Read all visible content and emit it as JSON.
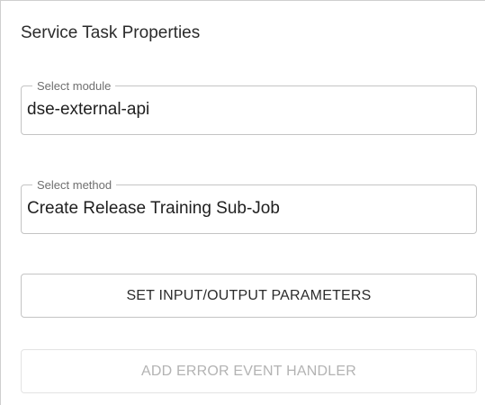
{
  "panel": {
    "title": "Service Task Properties"
  },
  "module_field": {
    "label": "Select module",
    "value": "dse-external-api"
  },
  "method_field": {
    "label": "Select method",
    "value": "Create Release Training Sub-Job"
  },
  "buttons": {
    "set_params_label": "SET INPUT/OUTPUT PARAMETERS",
    "add_error_handler_label": "ADD ERROR EVENT HANDLER",
    "add_error_handler_disabled": true
  },
  "colors": {
    "border": "#c4c4c4",
    "label_text": "#6f6f6f",
    "disabled_text": "#b3b3b3"
  }
}
